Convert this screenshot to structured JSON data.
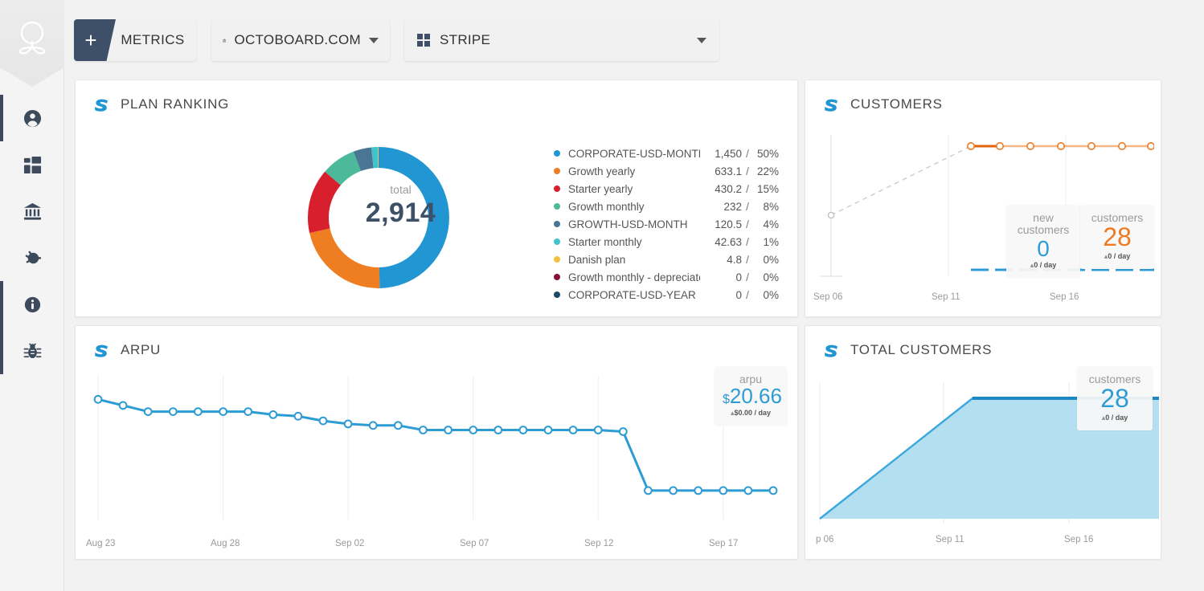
{
  "sidebar": {
    "logo_name": "octoboard-logo",
    "items": [
      {
        "name": "account",
        "icon": "user-circle-icon"
      },
      {
        "name": "dashboards",
        "icon": "dashboard-grid-icon"
      },
      {
        "name": "billing",
        "icon": "bank-icon"
      },
      {
        "name": "integrations",
        "icon": "plug-icon"
      },
      {
        "name": "info",
        "icon": "info-circle-icon"
      },
      {
        "name": "debug",
        "icon": "bug-icon"
      }
    ]
  },
  "toolbar": {
    "add_label": "+",
    "metrics_label": "METRICS",
    "board_label": "OCTOBOARD.COM",
    "board_icon": "bank-icon",
    "source_label": "STRIPE",
    "source_icon": "blocks-grid-icon",
    "caret_icon": "chevron-down-icon"
  },
  "panels": {
    "plan_ranking": {
      "title": "PLAN RANKING",
      "icon": "stripe-logo"
    },
    "customers": {
      "title": "CUSTOMERS",
      "icon": "stripe-logo"
    },
    "arpu": {
      "title": "ARPU",
      "icon": "stripe-logo"
    },
    "total_customers": {
      "title": "TOTAL CUSTOMERS",
      "icon": "stripe-logo"
    }
  },
  "donut": {
    "total_caption": "total",
    "total_value": "2,914"
  },
  "chart_data": [
    {
      "type": "pie",
      "title": "PLAN RANKING",
      "total": 2914,
      "total_label": "total",
      "legend_position": "right",
      "categories": [
        "CORPORATE-USD-MONTH",
        "Growth yearly",
        "Starter yearly",
        "Growth monthly",
        "GROWTH-USD-MONTH",
        "Starter monthly",
        "Danish plan",
        "Growth monthly - depreciated",
        "CORPORATE-USD-YEAR"
      ],
      "values": [
        1450,
        633.1,
        430.2,
        232,
        120.5,
        42.63,
        4.8,
        0,
        0
      ],
      "value_labels": [
        "1,450",
        "633.1",
        "430.2",
        "232",
        "120.5",
        "42.63",
        "4.8",
        "0",
        "0"
      ],
      "percent_labels": [
        "50%",
        "22%",
        "15%",
        "8%",
        "4%",
        "1%",
        "0%",
        "0%",
        "0%"
      ],
      "percents": [
        50,
        22,
        15,
        8,
        4,
        1,
        0,
        0,
        0
      ],
      "separator": "/",
      "colors": [
        "#2196d3",
        "#ef7d22",
        "#d81f2d",
        "#4cb99a",
        "#4a7694",
        "#3fc4c9",
        "#f2c13c",
        "#8c1036",
        "#1d4a66"
      ]
    },
    {
      "type": "line",
      "title": "CUSTOMERS",
      "xlabel": "",
      "ylabel": "",
      "grid": true,
      "xticks": [
        "Sep 06",
        "Sep 11",
        "Sep 16"
      ],
      "series": [
        {
          "name": "customers",
          "color": "#ee7b22",
          "values": [
            7,
            null,
            null,
            null,
            null,
            28,
            28,
            28,
            28,
            28,
            28,
            28,
            28
          ],
          "dashed_head": true
        },
        {
          "name": "new customers",
          "color": "#2e9cd4",
          "values": [
            0,
            0,
            0,
            0,
            0,
            0,
            0,
            0,
            0,
            0,
            0,
            0,
            0
          ],
          "dashed": true
        }
      ],
      "tooltips": [
        {
          "caption": "new customers",
          "value": "0",
          "sub": "0 / day",
          "color": "#2e9cd4"
        },
        {
          "caption": "customers",
          "value": "28",
          "sub": "0 / day",
          "color": "#ee7b22"
        }
      ]
    },
    {
      "type": "line",
      "title": "ARPU",
      "xlabel": "",
      "ylabel": "",
      "grid": true,
      "xticks": [
        "Aug 23",
        "Aug 28",
        "Sep 02",
        "Sep 07",
        "Sep 12",
        "Sep 17"
      ],
      "series": [
        {
          "name": "arpu",
          "color": "#2e9cd4",
          "values": [
            26.6,
            26.2,
            25.8,
            25.8,
            25.8,
            25.8,
            25.8,
            25.6,
            25.5,
            25.2,
            25.0,
            24.9,
            24.9,
            24.6,
            24.6,
            24.6,
            24.6,
            24.6,
            24.6,
            24.6,
            24.6,
            24.5,
            20.66,
            20.66,
            20.66,
            20.66,
            20.66,
            20.66
          ]
        }
      ],
      "tooltips": [
        {
          "caption": "arpu",
          "currency": "$",
          "value": "20.66",
          "sub": "$0.00 / day",
          "color": "#2e9cd4"
        }
      ]
    },
    {
      "type": "area",
      "title": "TOTAL CUSTOMERS",
      "xlabel": "",
      "ylabel": "",
      "grid": true,
      "xticks": [
        "p 06",
        "Sep 11",
        "Sep 16"
      ],
      "series": [
        {
          "name": "customers",
          "color": "#2e9cd4",
          "fill": "#b3dff0",
          "values": [
            0,
            3,
            6,
            9,
            12,
            15,
            18,
            21,
            24,
            27,
            28,
            28,
            28,
            28,
            28,
            28,
            28,
            28,
            28,
            28
          ]
        }
      ],
      "tooltips": [
        {
          "caption": "customers",
          "value": "28",
          "sub": "0 / day",
          "color": "#2e9cd4"
        }
      ]
    }
  ]
}
